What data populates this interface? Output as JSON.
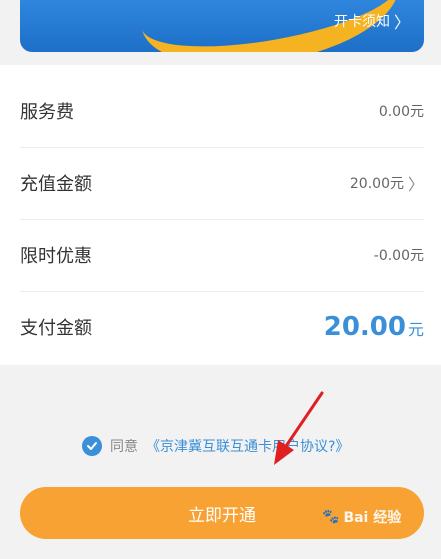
{
  "card": {
    "notice_label": "开卡须知"
  },
  "rows": [
    {
      "label": "服务费",
      "value": "0.00元"
    },
    {
      "label": "充值金额",
      "value": "20.00元"
    },
    {
      "label": "限时优惠",
      "value": "-0.00元"
    },
    {
      "label": "支付金额",
      "amount": "20.00",
      "unit": "元"
    }
  ],
  "agreement": {
    "prefix": "同意",
    "link": "《京津冀互联互通卡用户协议?》"
  },
  "button": {
    "label": "立即开通"
  },
  "watermark": {
    "text": "Bai 经验"
  },
  "colors": {
    "accent": "#3a8fd8",
    "button": "#f7a233",
    "arrow": "#e02020"
  }
}
